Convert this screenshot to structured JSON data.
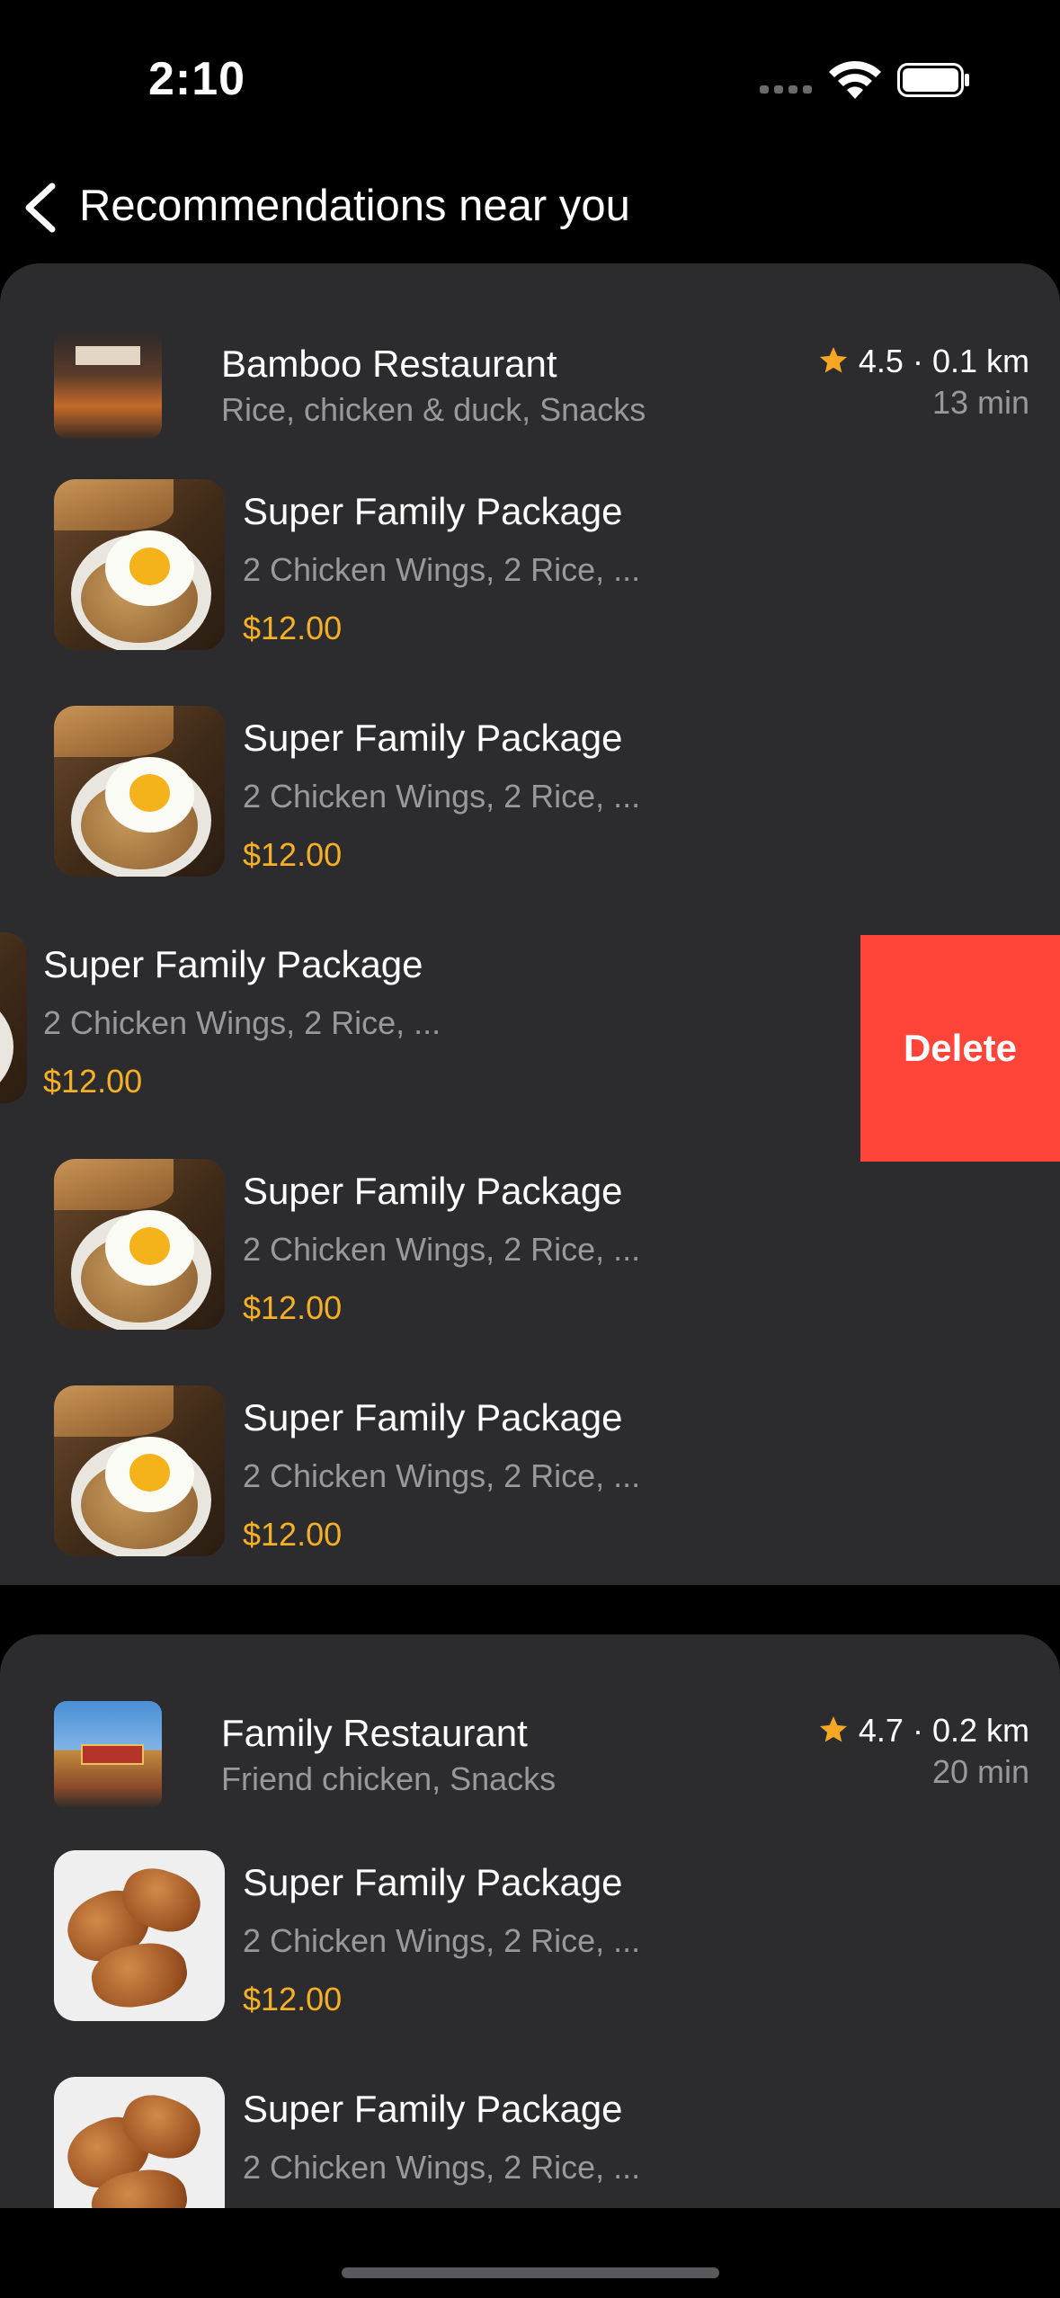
{
  "status_bar": {
    "time": "2:10",
    "icons": [
      "signal-icon",
      "wifi-icon",
      "battery-icon"
    ]
  },
  "nav": {
    "back_icon": "chevron-left-icon",
    "title": "Recommendations near you"
  },
  "colors": {
    "background": "#000000",
    "card": "#2c2c2f",
    "secondary_text": "#98989d",
    "price": "#f5b025",
    "star": "#f5a623",
    "delete": "#ff453a"
  },
  "restaurants": [
    {
      "name": "Bamboo Restaurant",
      "cuisine": "Rice, chicken & duck, Snacks",
      "rating": "4.5",
      "distance": "0.1 km",
      "eta": "13 min",
      "items": [
        {
          "name": "Super Family Package",
          "desc": "2 Chicken Wings, 2 Rice, ...",
          "price": "$12.00"
        },
        {
          "name": "Super Family Package",
          "desc": "2 Chicken Wings, 2 Rice, ...",
          "price": "$12.00"
        },
        {
          "name": "Super Family Package",
          "desc": "2 Chicken Wings, 2 Rice, ...",
          "price": "$12.00",
          "swiped": true,
          "action": "Delete"
        },
        {
          "name": "Super Family Package",
          "desc": "2 Chicken Wings, 2 Rice, ...",
          "price": "$12.00"
        },
        {
          "name": "Super Family Package",
          "desc": "2 Chicken Wings, 2 Rice, ...",
          "price": "$12.00"
        }
      ]
    },
    {
      "name": "Family Restaurant",
      "cuisine": "Friend chicken, Snacks",
      "rating": "4.7",
      "distance": "0.2 km",
      "eta": "20 min",
      "items": [
        {
          "name": "Super Family Package",
          "desc": "2 Chicken Wings, 2 Rice, ...",
          "price": "$12.00"
        },
        {
          "name": "Super Family Package",
          "desc": "2 Chicken Wings, 2 Rice, ..."
        }
      ]
    }
  ]
}
